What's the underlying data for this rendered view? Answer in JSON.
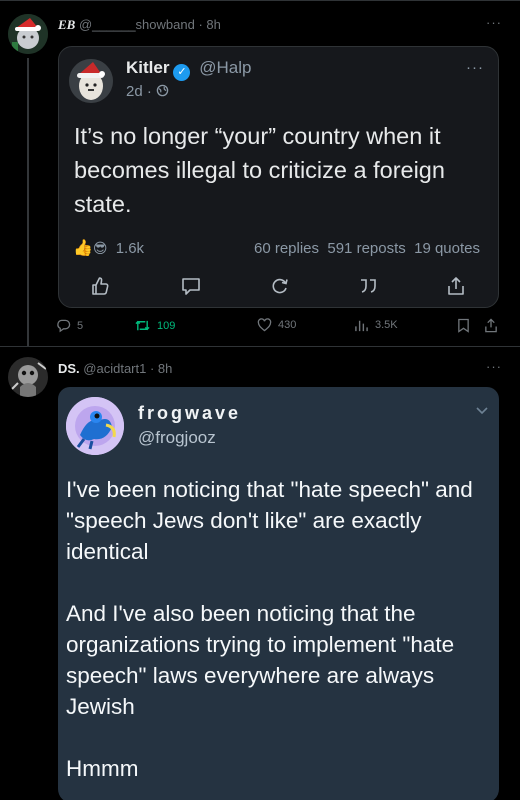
{
  "post1": {
    "author_name": "EB",
    "handle": "@______showband",
    "time": "· 8h",
    "more_label": "···",
    "quoted": {
      "name": "Kitler",
      "verified_mark": "✓",
      "handle": "@Halp",
      "time": "2d ·",
      "visibility_icon": "globe-icon",
      "text": "It’s no longer “your” country when it becomes illegal to criticize a foreign state.",
      "reactions_count": "1.6k",
      "replies": "60 replies",
      "reposts": "591 reposts",
      "quotes": "19 quotes",
      "more_label": "···"
    },
    "actions": {
      "replies": "5",
      "reposts": "109",
      "likes": "430",
      "views": "3.5K"
    }
  },
  "post2": {
    "author_name": "DS.",
    "handle": "@acidtart1",
    "time": "· 8h",
    "more_label": "···",
    "card": {
      "name": "frogwave",
      "handle": "@frogjooz",
      "paragraphs": [
        "I've been noticing that \"hate speech\" and \"speech Jews don't like\" are exactly identical",
        "And I've also been noticing that the organizations trying to implement \"hate speech\" laws everywhere are always Jewish",
        "Hmmm"
      ]
    }
  },
  "colors": {
    "background": "#000000",
    "card_dark": "#16181c",
    "card_blue": "#253341",
    "repost_green": "#00ba7c",
    "verified_blue": "#1d9bf0",
    "muted": "#71767b"
  }
}
